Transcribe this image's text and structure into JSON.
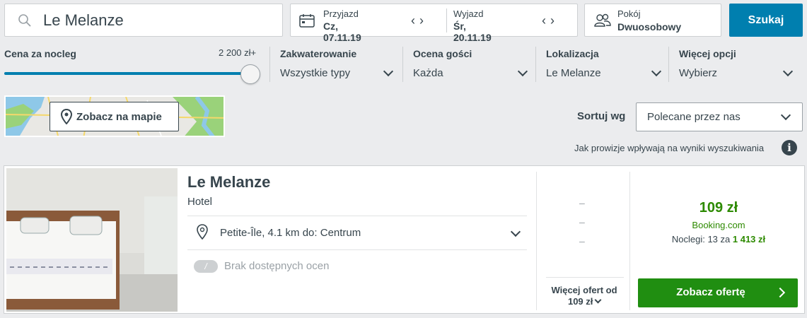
{
  "search": {
    "query": "Le Melanze",
    "checkin_label": "Przyjazd",
    "checkin_value": "Cz, 07.11.19",
    "checkout_label": "Wyjazd",
    "checkout_value": "Śr, 20.11.19",
    "room_label": "Pokój",
    "room_value": "Dwuosobowy",
    "submit_label": "Szukaj"
  },
  "filters": {
    "price_title": "Cena za nocleg",
    "price_max": "2 200 zł+",
    "price_slider_fraction": 1.0,
    "accommodation_title": "Zakwaterowanie",
    "accommodation_value": "Wszystkie typy",
    "rating_title": "Ocena gości",
    "rating_value": "Każda",
    "location_title": "Lokalizacja",
    "location_value": "Le Melanze",
    "more_title": "Więcej opcji",
    "more_value": "Wybierz"
  },
  "map": {
    "button_label": "Zobacz na mapie"
  },
  "sort": {
    "label": "Sortuj wg",
    "selected": "Polecane przez nas",
    "commission_note": "Jak prowizje wpływają na wyniki wyszukiwania",
    "info_icon": "i"
  },
  "result": {
    "name": "Le Melanze",
    "type": "Hotel",
    "location": "Petite-Île, 4.1 km do: Centrum",
    "rating_badge": "/",
    "rating_text": "Brak dostępnych ocen",
    "dashes": [
      "–",
      "–",
      "–"
    ],
    "more_offers_line1": "Więcej ofert od",
    "more_offers_line2": "109 zł",
    "price": "109 zł",
    "provider": "Booking.com",
    "nights_prefix": "Noclegi: 13 za",
    "nights_total": "1 413 zł",
    "offer_button": "Zobacz ofertę"
  },
  "colors": {
    "accent_blue": "#007faf",
    "price_green": "#2d8a00",
    "button_green": "#208e11",
    "text": "#37454d"
  }
}
